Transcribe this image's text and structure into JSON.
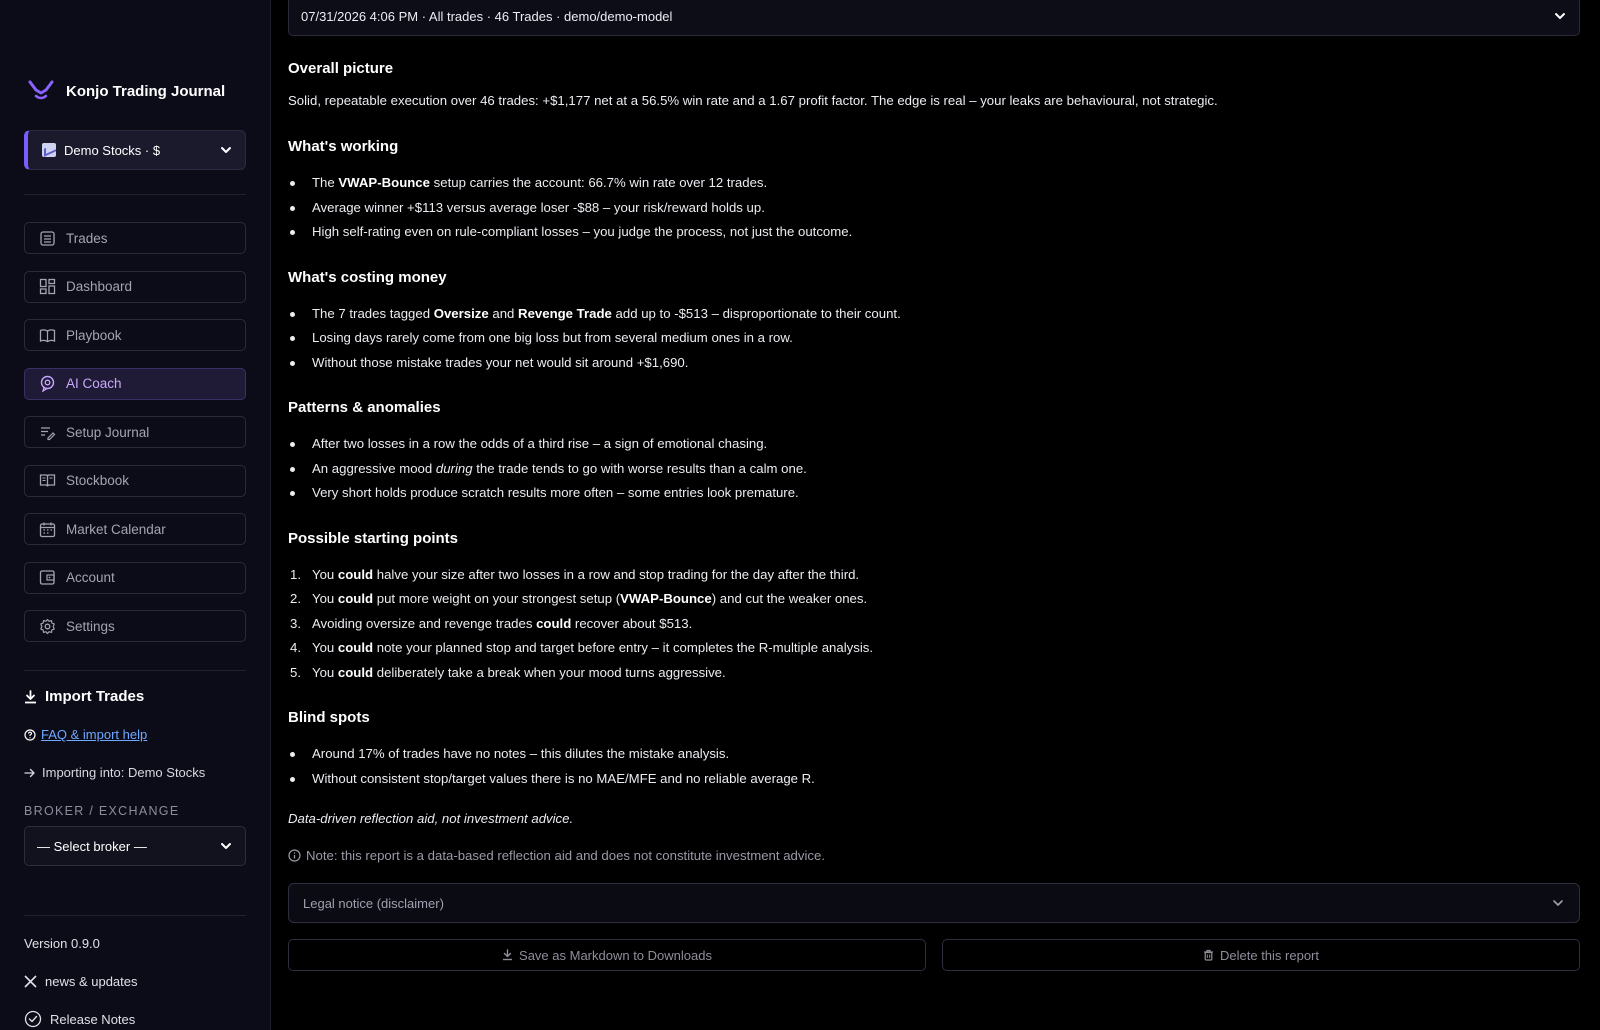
{
  "app": {
    "title": "Konjo Trading Journal"
  },
  "colors": {
    "accent": "#7b5cff",
    "active_text": "#c9a8ff",
    "link": "#6fa8ff"
  },
  "sidebar": {
    "account_select": {
      "label": "Demo Stocks · $",
      "icon": "chart-icon"
    },
    "nav": [
      {
        "label": "Trades",
        "icon": "list-icon",
        "active": false
      },
      {
        "label": "Dashboard",
        "icon": "grid-icon",
        "active": false
      },
      {
        "label": "Playbook",
        "icon": "book-open-icon",
        "active": false
      },
      {
        "label": "AI Coach",
        "icon": "ai-coach-icon",
        "active": true
      },
      {
        "label": "Setup Journal",
        "icon": "edit-list-icon",
        "active": false
      },
      {
        "label": "Stockbook",
        "icon": "book-icon",
        "active": false
      },
      {
        "label": "Market Calendar",
        "icon": "calendar-icon",
        "active": false
      },
      {
        "label": "Account",
        "icon": "wallet-icon",
        "active": false
      },
      {
        "label": "Settings",
        "icon": "gear-icon",
        "active": false
      }
    ],
    "import": {
      "title": "Import Trades",
      "faq_link": "FAQ & import help",
      "importing_into": "Importing into: Demo Stocks",
      "broker_label": "BROKER / EXCHANGE",
      "broker_placeholder": "— Select broker —"
    },
    "footer": {
      "version": "Version 0.9.0",
      "news": "news & updates",
      "release_notes": "Release Notes"
    }
  },
  "main": {
    "report_select": "07/31/2026 4:06 PM · All trades · 46 Trades · demo/demo-model",
    "overall": {
      "heading": "Overall picture",
      "text": "Solid, repeatable execution over 46 trades: +$1,177 net at a 56.5% win rate and a 1.67 profit factor. The edge is real – your leaks are behavioural, not strategic."
    },
    "working": {
      "heading": "What's working",
      "items": [
        {
          "pre": "The ",
          "bold": "VWAP-Bounce",
          "post": " setup carries the account: 66.7% win rate over 12 trades."
        },
        {
          "text": "Average winner +$113 versus average loser -$88 – your risk/reward holds up."
        },
        {
          "text": "High self-rating even on rule-compliant losses – you judge the process, not just the outcome."
        }
      ]
    },
    "costing": {
      "heading": "What's costing money",
      "item1": {
        "a": "The 7 trades tagged ",
        "b1": "Oversize",
        "c": " and ",
        "b2": "Revenge Trade",
        "d": " add up to -$513 – disproportionate to their count."
      },
      "items": [
        "Losing days rarely come from one big loss but from several medium ones in a row.",
        "Without those mistake trades your net would sit around +$1,690."
      ]
    },
    "patterns": {
      "heading": "Patterns & anomalies",
      "item1": "After two losses in a row the odds of a third rise – a sign of emotional chasing.",
      "item2": {
        "pre": "An aggressive mood ",
        "em": "during",
        "post": " the trade tends to go with worse results than a calm one."
      },
      "item3": "Very short holds produce scratch results more often – some entries look premature."
    },
    "starting": {
      "heading": "Possible starting points",
      "items": [
        {
          "n": "1.",
          "pre": "You ",
          "bold": "could",
          "post": " halve your size after two losses in a row and stop trading for the day after the third."
        },
        {
          "n": "2.",
          "pre": "You ",
          "bold": "could",
          "post": " put more weight on your strongest setup (",
          "bold2": "VWAP-Bounce",
          "post2": ") and cut the weaker ones."
        },
        {
          "n": "3.",
          "pre": "Avoiding oversize and revenge trades ",
          "bold": "could",
          "post": " recover about $513."
        },
        {
          "n": "4.",
          "pre": "You ",
          "bold": "could",
          "post": " note your planned stop and target before entry – it completes the R-multiple analysis."
        },
        {
          "n": "5.",
          "pre": "You ",
          "bold": "could",
          "post": " deliberately take a break when your mood turns aggressive."
        }
      ]
    },
    "blind": {
      "heading": "Blind spots",
      "items": [
        "Around 17% of trades have no notes – this dilutes the mistake analysis.",
        "Without consistent stop/target values there is no MAE/MFE and no reliable average R."
      ]
    },
    "italic_note": "Data-driven reflection aid, not investment advice.",
    "note": "Note: this report is a data-based reflection aid and does not constitute investment advice.",
    "legal_notice": "Legal notice (disclaimer)",
    "save_button": "Save as Markdown to Downloads",
    "delete_button": "Delete this report"
  }
}
